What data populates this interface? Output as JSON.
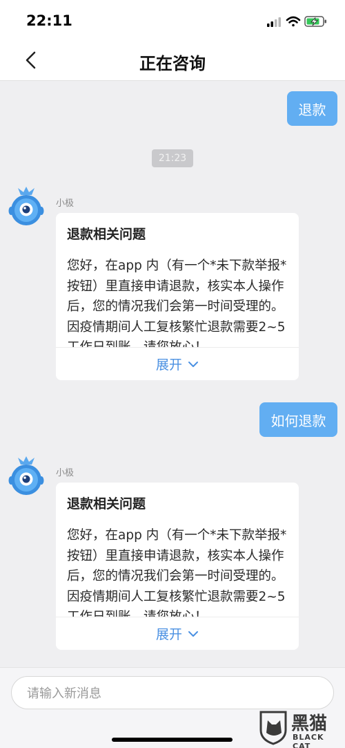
{
  "status_bar": {
    "time": "22:11"
  },
  "nav": {
    "title": "正在咨询"
  },
  "messages": {
    "m1": {
      "text": "退款"
    },
    "timestamp": "21:23",
    "bot1": {
      "name": "小极",
      "title": "退款相关问题",
      "text": "您好，在app 内（有一个*未下款举报*按钮）里直接申请退款，核实本人操作后，您的情况我们会第一时间受理的。因疫情期间人工复核繁忙退款需要2~5工作日到账，请您放心！",
      "expand": "展开"
    },
    "m2": {
      "text": "如何退款"
    },
    "bot2": {
      "name": "小极",
      "title": "退款相关问题",
      "text": "您好，在app 内（有一个*未下款举报*按钮）里直接申请退款，核实本人操作后，您的情况我们会第一时间受理的。因疫情期间人工复核繁忙退款需要2~5工作日到账，请您放心！",
      "expand": "展开"
    }
  },
  "input": {
    "placeholder": "请输入新消息"
  },
  "watermark": {
    "text": "黑猫",
    "sub": "BLACK CAT"
  },
  "colors": {
    "user_bubble": "#62aef2",
    "link": "#4a90e2",
    "background": "#efeff1"
  },
  "icons": {
    "back": "chevron-left-icon",
    "expand": "chevron-down-icon",
    "avatar": "robot-avatar"
  }
}
